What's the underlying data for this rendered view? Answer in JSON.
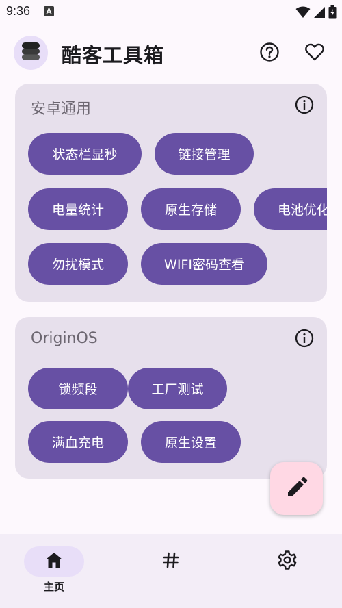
{
  "status_bar": {
    "time": "9:36"
  },
  "app_bar": {
    "title": "酷客工具箱"
  },
  "sections": [
    {
      "title": "安卓通用",
      "chips": [
        "状态栏显秒",
        "链接管理",
        "电量统计",
        "原生存储",
        "电池优化",
        "勿扰模式",
        "WIFI密码查看"
      ]
    },
    {
      "title": "OriginOS",
      "chips": [
        "锁频段",
        "工厂测试",
        "满血充电",
        "原生设置"
      ]
    }
  ],
  "bottom_nav": {
    "items": [
      {
        "label": "主页",
        "icon": "home-icon",
        "active": true
      },
      {
        "label": "",
        "icon": "hashtag-icon",
        "active": false
      },
      {
        "label": "",
        "icon": "settings-icon",
        "active": false
      }
    ]
  },
  "colors": {
    "chip": "#6750a4",
    "card": "#e7e0ec",
    "fab": "#ffd8e4",
    "nav_active": "#e8def8"
  }
}
